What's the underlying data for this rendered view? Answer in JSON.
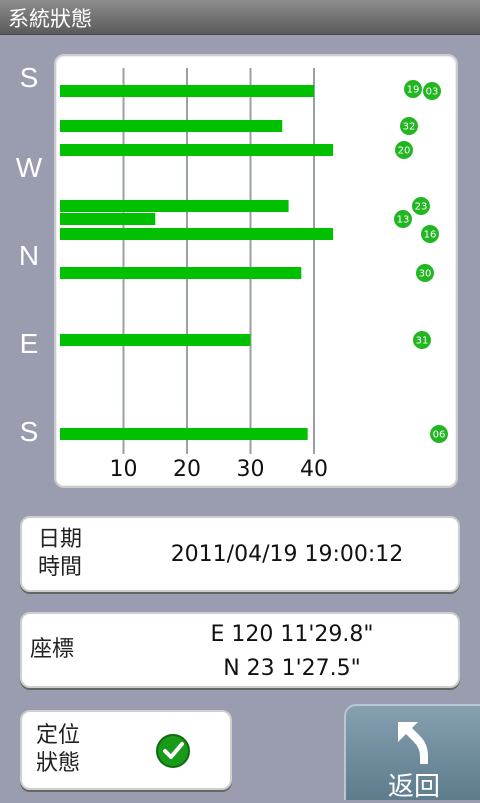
{
  "title": "系統狀態",
  "compass": [
    "S",
    "W",
    "N",
    "E",
    "S"
  ],
  "chart_data": {
    "type": "bar",
    "orientation": "horizontal",
    "x_ticks": [
      "10",
      "20",
      "30",
      "40"
    ],
    "xlim": [
      0,
      50
    ],
    "bars": [
      {
        "value": 40,
        "sat": "19"
      },
      {
        "value": 35,
        "sat": "32"
      },
      {
        "value": 43,
        "sat": "20"
      },
      {
        "value": 36,
        "sat": "23"
      },
      {
        "value": 15,
        "sat": "13"
      },
      {
        "value": 43,
        "sat": "16"
      },
      {
        "value": 38,
        "sat": "30"
      },
      {
        "value": 30,
        "sat": "31"
      },
      {
        "value": 39,
        "sat": "06"
      }
    ],
    "satellite_ids": [
      "19",
      "03",
      "32",
      "20",
      "23",
      "13",
      "16",
      "30",
      "31",
      "06"
    ],
    "bar_color": "#00c000",
    "marker_color": "#22b722"
  },
  "datetime": {
    "label_line1": "日期",
    "label_line2": "時間",
    "value": "2011/04/19 19:00:12"
  },
  "coordinates": {
    "label": "座標",
    "east": "E 120 11'29.8\"",
    "north": "N  23  1'27.5\""
  },
  "position_status": {
    "label_line1": "定位",
    "label_line2": "狀態",
    "fixed": true
  },
  "back_button": {
    "label": "返回"
  }
}
